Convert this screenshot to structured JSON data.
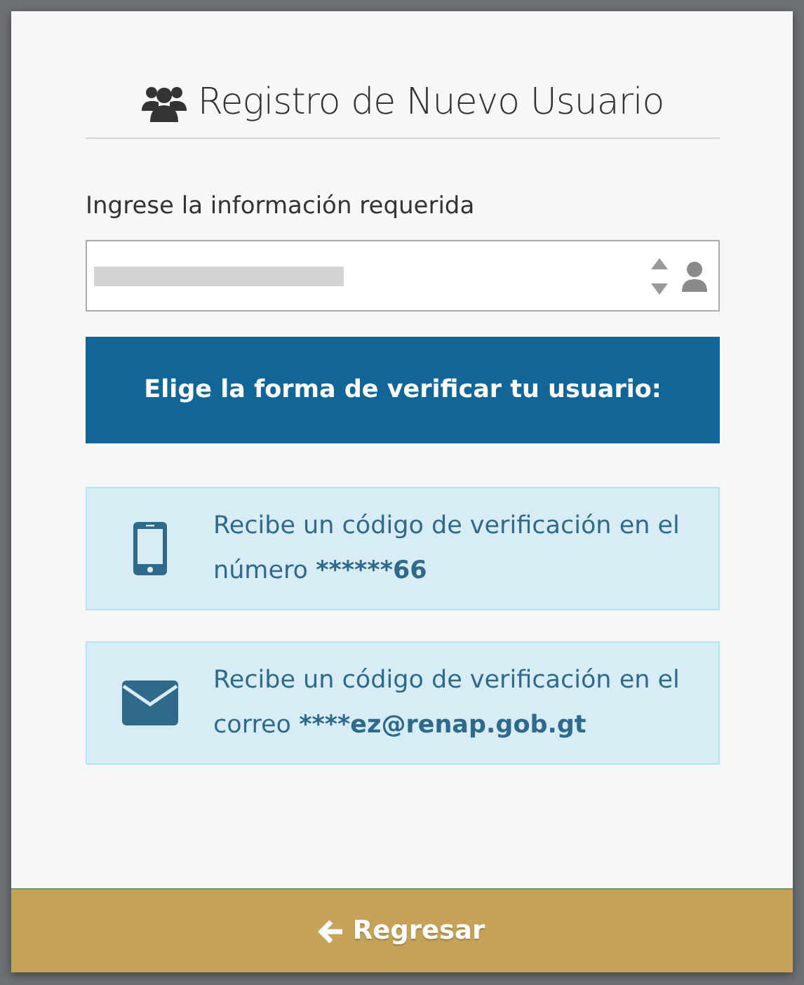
{
  "title": "Registro de Nuevo Usuario",
  "field": {
    "label": "Ingrese la información requerida"
  },
  "banner": "Elige la forma de verificar tu usuario:",
  "options": [
    {
      "kind": "phone",
      "text": "Recibe un código de verificación en el número ",
      "masked_value": "******66"
    },
    {
      "kind": "email",
      "text": "Recibe un código de verificación en el correo ",
      "masked_value": "****ez@renap.gob.gt"
    }
  ],
  "back_button": {
    "label": "Regresar"
  }
}
